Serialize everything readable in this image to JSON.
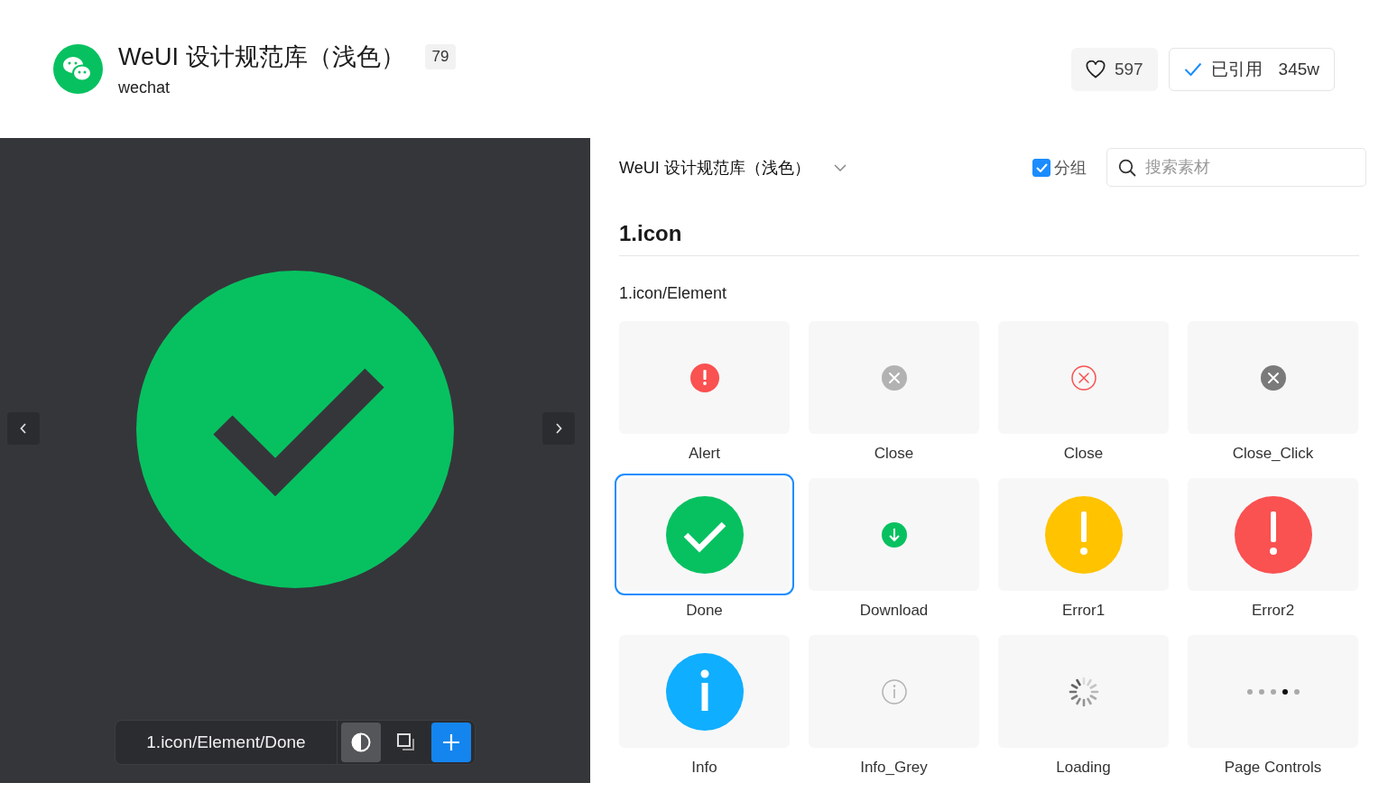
{
  "header": {
    "title": "WeUI 设计规范库（浅色）",
    "count": "79",
    "owner": "wechat",
    "likes": "597",
    "cited_label": "已引用",
    "cited_count": "345w"
  },
  "preview": {
    "path": "1.icon/Element/Done",
    "tools": [
      {
        "kind": "contrast",
        "on": true
      },
      {
        "kind": "copy",
        "on": false
      },
      {
        "kind": "add"
      }
    ]
  },
  "browser": {
    "library": "WeUI 设计规范库（浅色）",
    "group": {
      "label": "分组",
      "checked": true
    },
    "search": {
      "placeholder": "搜索素材"
    },
    "section": "1.icon",
    "subsection": "1.icon/Element",
    "items": [
      {
        "name": "Alert",
        "kind": "alert",
        "selected": false
      },
      {
        "name": "Close",
        "kind": "close-grey",
        "selected": false
      },
      {
        "name": "Close",
        "kind": "close-outline",
        "selected": false
      },
      {
        "name": "Close_Click",
        "kind": "close-dark",
        "selected": false
      },
      {
        "name": "Done",
        "kind": "done",
        "selected": true
      },
      {
        "name": "Download",
        "kind": "download",
        "selected": false
      },
      {
        "name": "Error1",
        "kind": "warn",
        "selected": false
      },
      {
        "name": "Error2",
        "kind": "error",
        "selected": false
      },
      {
        "name": "Info",
        "kind": "info",
        "selected": false
      },
      {
        "name": "Info_Grey",
        "kind": "info-grey",
        "selected": false
      },
      {
        "name": "Loading",
        "kind": "loading",
        "selected": false
      },
      {
        "name": "Page Controls",
        "kind": "dots",
        "selected": false
      }
    ]
  }
}
